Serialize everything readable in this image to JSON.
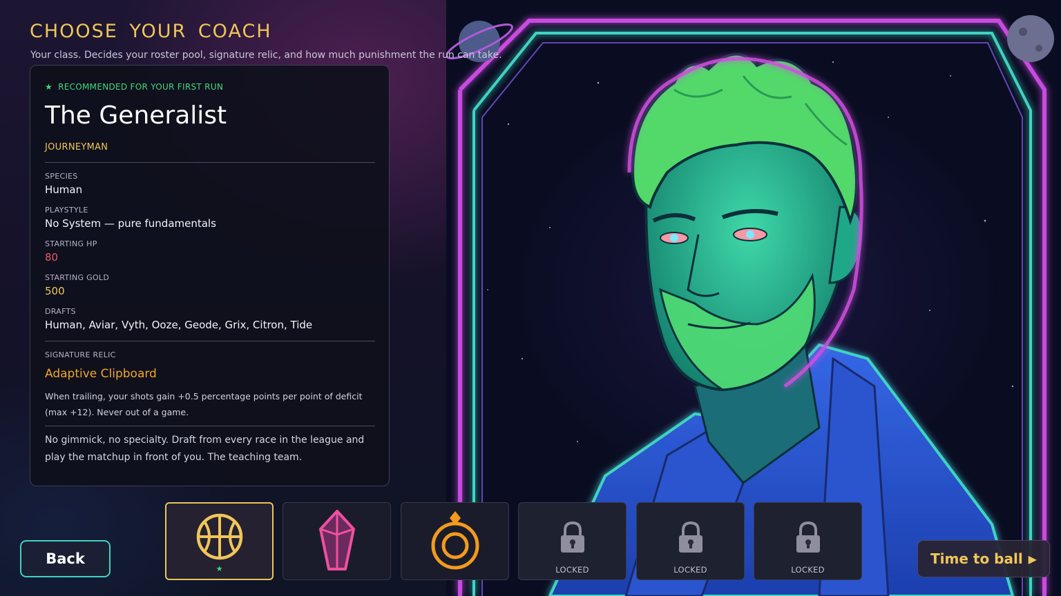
{
  "header": {
    "title": "CHOOSE YOUR COACH",
    "subtitle": "Your class. Decides your roster pool, signature relic, and how much punishment the run can take."
  },
  "card": {
    "recommended": "RECOMMENDED FOR YOUR FIRST RUN",
    "recommended_icon": "star-icon",
    "name": "The Generalist",
    "tier": "JOURNEYMAN",
    "stats": {
      "species_label": "SPECIES",
      "species": "Human",
      "playstyle_label": "PLAYSTYLE",
      "playstyle": "No System — pure fundamentals",
      "hp_label": "STARTING HP",
      "hp": "80",
      "gold_label": "STARTING GOLD",
      "gold": "500",
      "drafts_label": "DRAFTS",
      "drafts": "Human, Aviar, Vyth, Ooze, Geode, Grix, Citron, Tide"
    },
    "relic": {
      "label": "SIGNATURE RELIC",
      "name": "Adaptive Clipboard",
      "description": "When trailing, your shots gain +0.5 percentage points per point of deficit (max +12). Never out of a game."
    },
    "description": "No gimmick, no specialty. Draft from every race in the league and play the matchup in front of you. The teaching team."
  },
  "buttons": {
    "back": "Back",
    "confirm": "Time to ball",
    "confirm_icon": "play-arrow-icon"
  },
  "classes": [
    {
      "icon": "basketball-icon",
      "label": "★",
      "state": "selected",
      "color": "#f0c659"
    },
    {
      "icon": "crystal-icon",
      "label": "",
      "state": "available",
      "color": "#f0509e"
    },
    {
      "icon": "ring-icon",
      "label": "",
      "state": "available",
      "color": "#f39a1e"
    },
    {
      "icon": "lock-icon",
      "label": "LOCKED",
      "state": "locked"
    },
    {
      "icon": "lock-icon",
      "label": "LOCKED",
      "state": "locked"
    },
    {
      "icon": "lock-icon",
      "label": "LOCKED",
      "state": "locked"
    }
  ],
  "colors": {
    "accent_gold": "#f0c659",
    "accent_green": "#43d97c",
    "hp_red": "#f0566a",
    "relic_orange": "#f0a72a",
    "frame_teal": "#3fd3c2",
    "frame_magenta": "#d04fe0"
  }
}
